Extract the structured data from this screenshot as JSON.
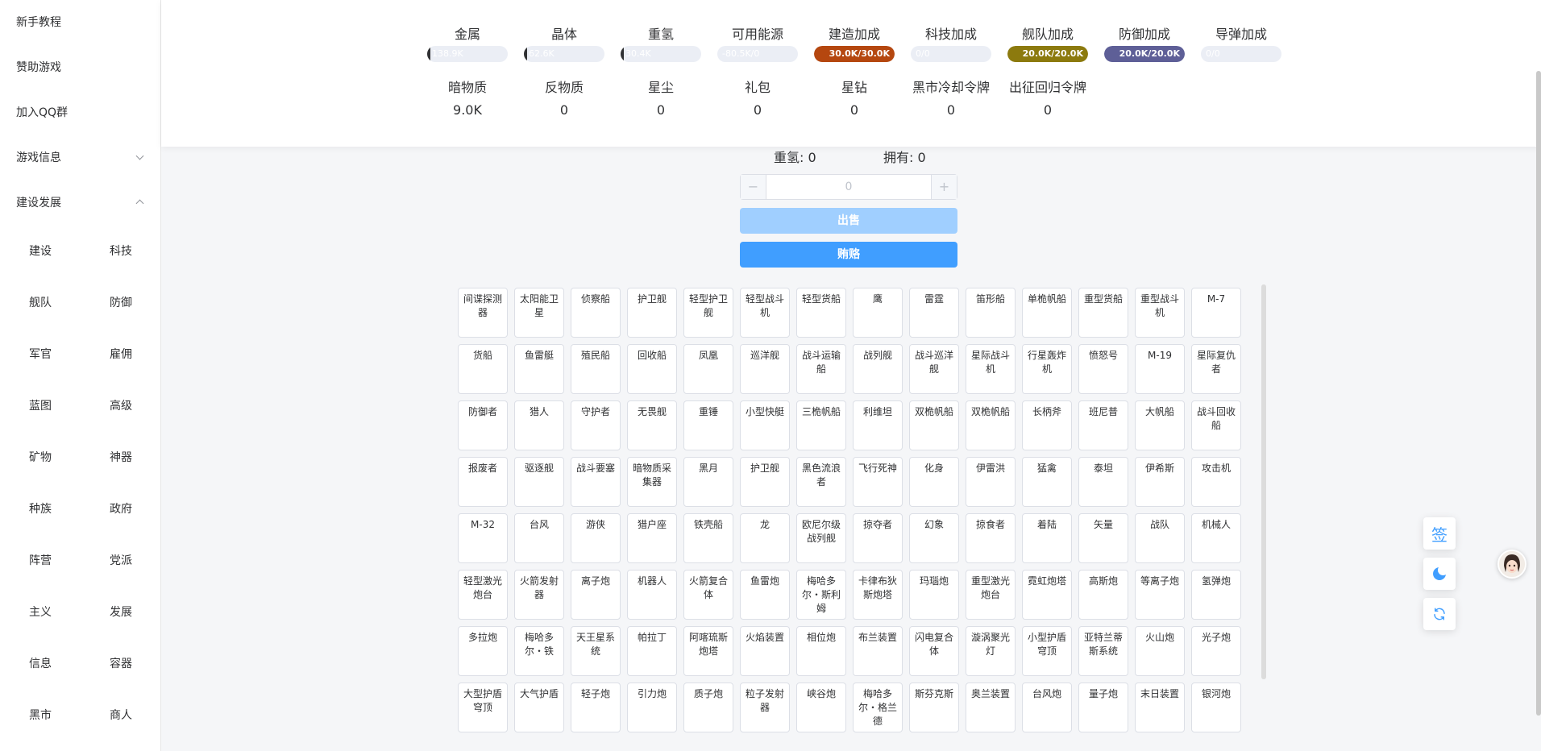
{
  "sidebar": {
    "items": [
      {
        "label": "新手教程"
      },
      {
        "label": "赞助游戏"
      },
      {
        "label": "加入QQ群"
      },
      {
        "label": "游戏信息"
      },
      {
        "label": "建设发展"
      }
    ],
    "sub_items": [
      "建设",
      "科技",
      "舰队",
      "防御",
      "军官",
      "雇佣",
      "蓝图",
      "高级",
      "矿物",
      "神器",
      "种族",
      "政府",
      "阵营",
      "党派",
      "主义",
      "发展",
      "信息",
      "容器",
      "黑市",
      "商人"
    ]
  },
  "resources": {
    "row1": [
      {
        "name": "金属",
        "bar_text": "138.9K",
        "fill": 0.02,
        "color": "#303133"
      },
      {
        "name": "晶体",
        "bar_text": "62.6K",
        "fill": 0.02,
        "color": "#303133"
      },
      {
        "name": "重氢",
        "bar_text": "30.4K",
        "fill": 0.02,
        "color": "#303133"
      },
      {
        "name": "可用能源",
        "bar_text": "-80.5K/0",
        "fill": 0,
        "color": "#303133"
      },
      {
        "name": "建造加成",
        "bar_text": "30.0K/30.0K",
        "fill": 1,
        "color": "#b5470f"
      },
      {
        "name": "科技加成",
        "bar_text": "0/0",
        "fill": 0,
        "color": "#303133"
      },
      {
        "name": "舰队加成",
        "bar_text": "20.0K/20.0K",
        "fill": 1,
        "color": "#8c7a0e"
      },
      {
        "name": "防御加成",
        "bar_text": "20.0K/20.0K",
        "fill": 1,
        "color": "#5e5f97"
      },
      {
        "name": "导弹加成",
        "bar_text": "0/0",
        "fill": 0,
        "color": "#303133"
      }
    ],
    "row2": [
      {
        "name": "暗物质",
        "value": "9.0K"
      },
      {
        "name": "反物质",
        "value": "0"
      },
      {
        "name": "星尘",
        "value": "0"
      },
      {
        "name": "礼包",
        "value": "0"
      },
      {
        "name": "星钻",
        "value": "0"
      },
      {
        "name": "黑市冷却令牌",
        "value": "0"
      },
      {
        "name": "出征回归令牌",
        "value": "0"
      }
    ]
  },
  "trade": {
    "resource_label": "重氢: 0",
    "owned_label": "拥有: 0",
    "minus": "−",
    "plus": "+",
    "quantity_placeholder": "0",
    "sell_label": "出售",
    "bribe_label": "贿赂"
  },
  "items": [
    "间谍探测器",
    "太阳能卫星",
    "侦察船",
    "护卫舰",
    "轻型护卫舰",
    "轻型战斗机",
    "轻型货船",
    "鹰",
    "雷霆",
    "笛形船",
    "单桅帆船",
    "重型货船",
    "重型战斗机",
    "M-7",
    "货船",
    "鱼雷艇",
    "殖民船",
    "回收船",
    "凤凰",
    "巡洋舰",
    "战斗运输船",
    "战列舰",
    "战斗巡洋舰",
    "星际战斗机",
    "行星轰炸机",
    "愤怒号",
    "M-19",
    "星际复仇者",
    "防御者",
    "猎人",
    "守护者",
    "无畏舰",
    "重锤",
    "小型快艇",
    "三桅帆船",
    "利维坦",
    "双桅帆船",
    "双桅帆船",
    "长柄斧",
    "班尼普",
    "大帆船",
    "战斗回收船",
    "报废者",
    "驱逐舰",
    "战斗要塞",
    "暗物质采集器",
    "黑月",
    "护卫舰",
    "黑色流浪者",
    "飞行死神",
    "化身",
    "伊雷洪",
    "猛禽",
    "泰坦",
    "伊希斯",
    "攻击机",
    "M-32",
    "台风",
    "游侠",
    "猎户座",
    "铁壳船",
    "龙",
    "欧尼尔级战列舰",
    "掠夺者",
    "幻象",
    "掠食者",
    "着陆",
    "矢量",
    "战队",
    "机械人",
    "轻型激光炮台",
    "火箭发射器",
    "离子炮",
    "机器人",
    "火箭复合体",
    "鱼雷炮",
    "梅哈多尔・斯利姆",
    "卡律布狄斯炮塔",
    "玛瑙炮",
    "重型激光炮台",
    "霓虹炮塔",
    "高斯炮",
    "等离子炮",
    "氢弹炮",
    "多拉炮",
    "梅哈多尔・铁",
    "天王星系统",
    "帕拉丁",
    "阿喀琉斯炮塔",
    "火焰装置",
    "相位炮",
    "布兰装置",
    "闪电复合体",
    "漩涡聚光灯",
    "小型护盾穹顶",
    "亚特兰蒂斯系统",
    "火山炮",
    "光子炮",
    "大型护盾穹顶",
    "大气护盾",
    "轻子炮",
    "引力炮",
    "质子炮",
    "粒子发射器",
    "峡谷炮",
    "梅哈多尔・格兰德",
    "斯芬克斯",
    "奥兰装置",
    "台风炮",
    "量子炮",
    "末日装置",
    "银河炮"
  ],
  "float": {
    "sign_label": "签"
  }
}
